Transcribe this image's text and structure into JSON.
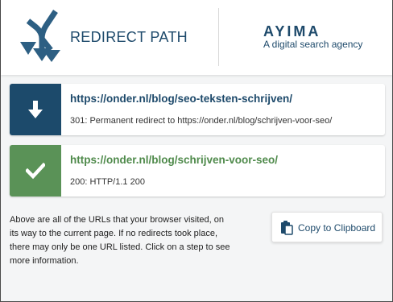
{
  "header": {
    "brand_name": "REDIRECT PATH",
    "company_name": "AYIMA",
    "company_tagline": "A digital search agency",
    "brand_logo_icon": "fork-arrows-icon",
    "brand_color": "#1e4a6b"
  },
  "redirects": [
    {
      "url": "https://onder.nl/blog/seo-teksten-schrijven/",
      "status": "301: Permanent redirect to https://onder.nl/blog/schrijven-voor-seo/",
      "icon": "arrow-down-icon",
      "color": "#1c4a6b"
    },
    {
      "url": "https://onder.nl/blog/schrijven-voor-seo/",
      "status": "200: HTTP/1.1 200",
      "icon": "checkmark-icon",
      "color": "#5a9257"
    }
  ],
  "info": {
    "text": "Above are all of the URLs that your browser visited, on its way to the current page. If no redirects took place, there may only be one URL listed. Click on a step to see more information."
  },
  "copy_button": {
    "label": "Copy to Clipboard",
    "icon": "clipboard-icon"
  }
}
